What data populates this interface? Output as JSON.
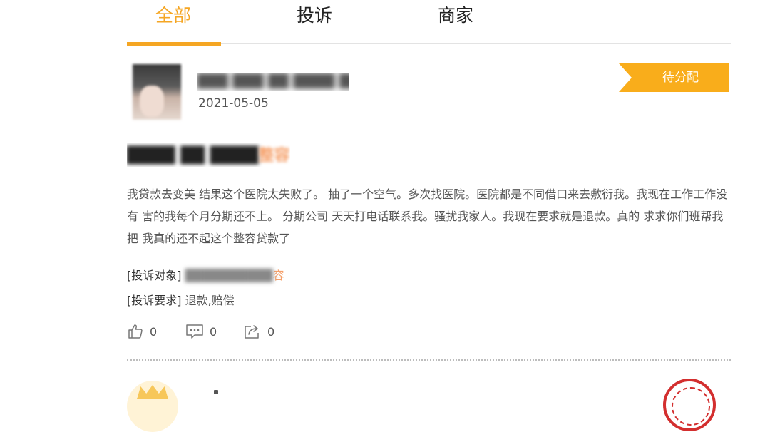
{
  "tabs": [
    {
      "label": "全部",
      "active": true
    },
    {
      "label": "投诉",
      "active": false
    },
    {
      "label": "商家",
      "active": false
    }
  ],
  "colors": {
    "accent": "#f5a623",
    "status_bg": "#f9ad1b",
    "seal": "#d32f2f"
  },
  "post": {
    "user_name": "███ ███ ██ ████ ██ ████",
    "date": "2021-05-05",
    "status": "待分配",
    "title_prefix": "████ ██ ████",
    "title_suffix": "整容",
    "content": "我贷款去变美 结果这个医院太失败了。 抽了一个空气。多次找医院。医院都是不同借口来去敷衍我。我现在工作工作没有 害的我每个月分期还不上。 分期公司 天天打电话联系我。骚扰我家人。我现在要求就是退款。真的 求求你们班帮我把 我真的还不起这个整容贷款了",
    "target_label": "[投诉对象]",
    "target_value_blurred": "██████████",
    "target_value_suffix": "容",
    "demand_label": "[投诉要求]",
    "demand_value": "退款,赔偿",
    "likes": "0",
    "comments": "0",
    "shares": "0"
  },
  "icons": {
    "like": "thumbs-up-icon",
    "comment": "comment-icon",
    "share": "share-icon"
  }
}
